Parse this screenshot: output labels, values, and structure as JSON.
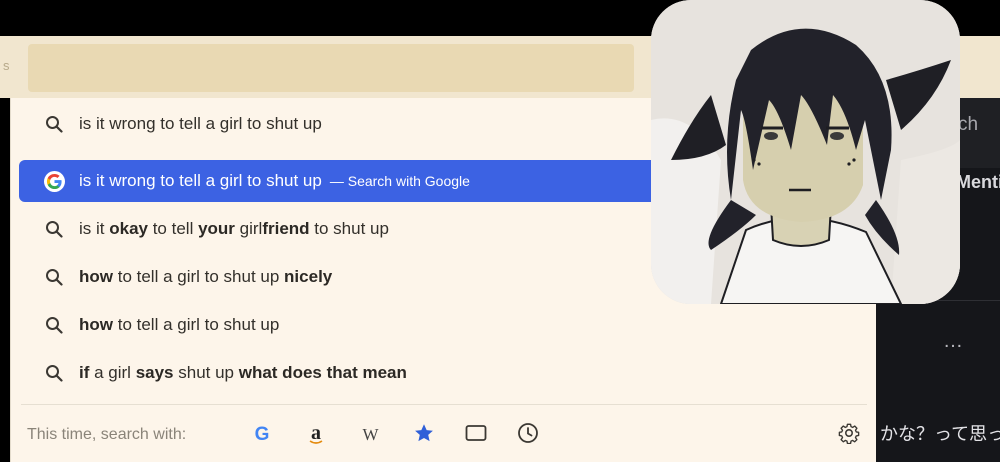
{
  "chrome": {
    "url_letter": "s",
    "right_fragment_search": "ch",
    "right_fragment_menu": "Menti",
    "right_more_dots": "…",
    "right_japanese_text": "かな？って思っ"
  },
  "suggestions": [
    {
      "icon": "search-icon",
      "parts": [
        {
          "t": "is it wrong to tell a girl to shut up",
          "b": false
        }
      ]
    },
    {
      "icon": "google-icon",
      "parts": [
        {
          "t": "is it wrong to tell a girl to shut up",
          "b": false
        }
      ],
      "suffix": "—  Search with Google",
      "selected": true
    },
    {
      "icon": "search-icon",
      "parts": [
        {
          "t": "is it ",
          "b": false
        },
        {
          "t": "okay",
          "b": true
        },
        {
          "t": " to tell ",
          "b": false
        },
        {
          "t": "your",
          "b": true
        },
        {
          "t": " girl",
          "b": false
        },
        {
          "t": "friend",
          "b": true
        },
        {
          "t": " to shut up",
          "b": false
        }
      ]
    },
    {
      "icon": "search-icon",
      "parts": [
        {
          "t": "how",
          "b": true
        },
        {
          "t": " to tell a girl to shut up ",
          "b": false
        },
        {
          "t": "nicely",
          "b": true
        }
      ]
    },
    {
      "icon": "search-icon",
      "parts": [
        {
          "t": "how",
          "b": true
        },
        {
          "t": " to tell a girl to shut up",
          "b": false
        }
      ]
    },
    {
      "icon": "search-icon",
      "parts": [
        {
          "t": "if",
          "b": true
        },
        {
          "t": " a girl ",
          "b": false
        },
        {
          "t": "says",
          "b": true
        },
        {
          "t": " shut up ",
          "b": false
        },
        {
          "t": "what does that mean",
          "b": true
        }
      ]
    }
  ],
  "footer": {
    "label": "This time, search with:",
    "engines": [
      {
        "name": "google-engine",
        "glyph": "G"
      },
      {
        "name": "amazon-engine",
        "glyph": "a"
      },
      {
        "name": "wikipedia-engine",
        "glyph": "W"
      },
      {
        "name": "bookmarks-engine",
        "glyph": "★"
      },
      {
        "name": "tabs-engine",
        "glyph": ""
      },
      {
        "name": "history-engine",
        "glyph": ""
      }
    ]
  },
  "colors": {
    "selected_row": "#3c62e3",
    "dropdown_bg": "#fdf5ea",
    "google_blue": "#4285f4",
    "bookmark_blue": "#2f5fd8"
  }
}
